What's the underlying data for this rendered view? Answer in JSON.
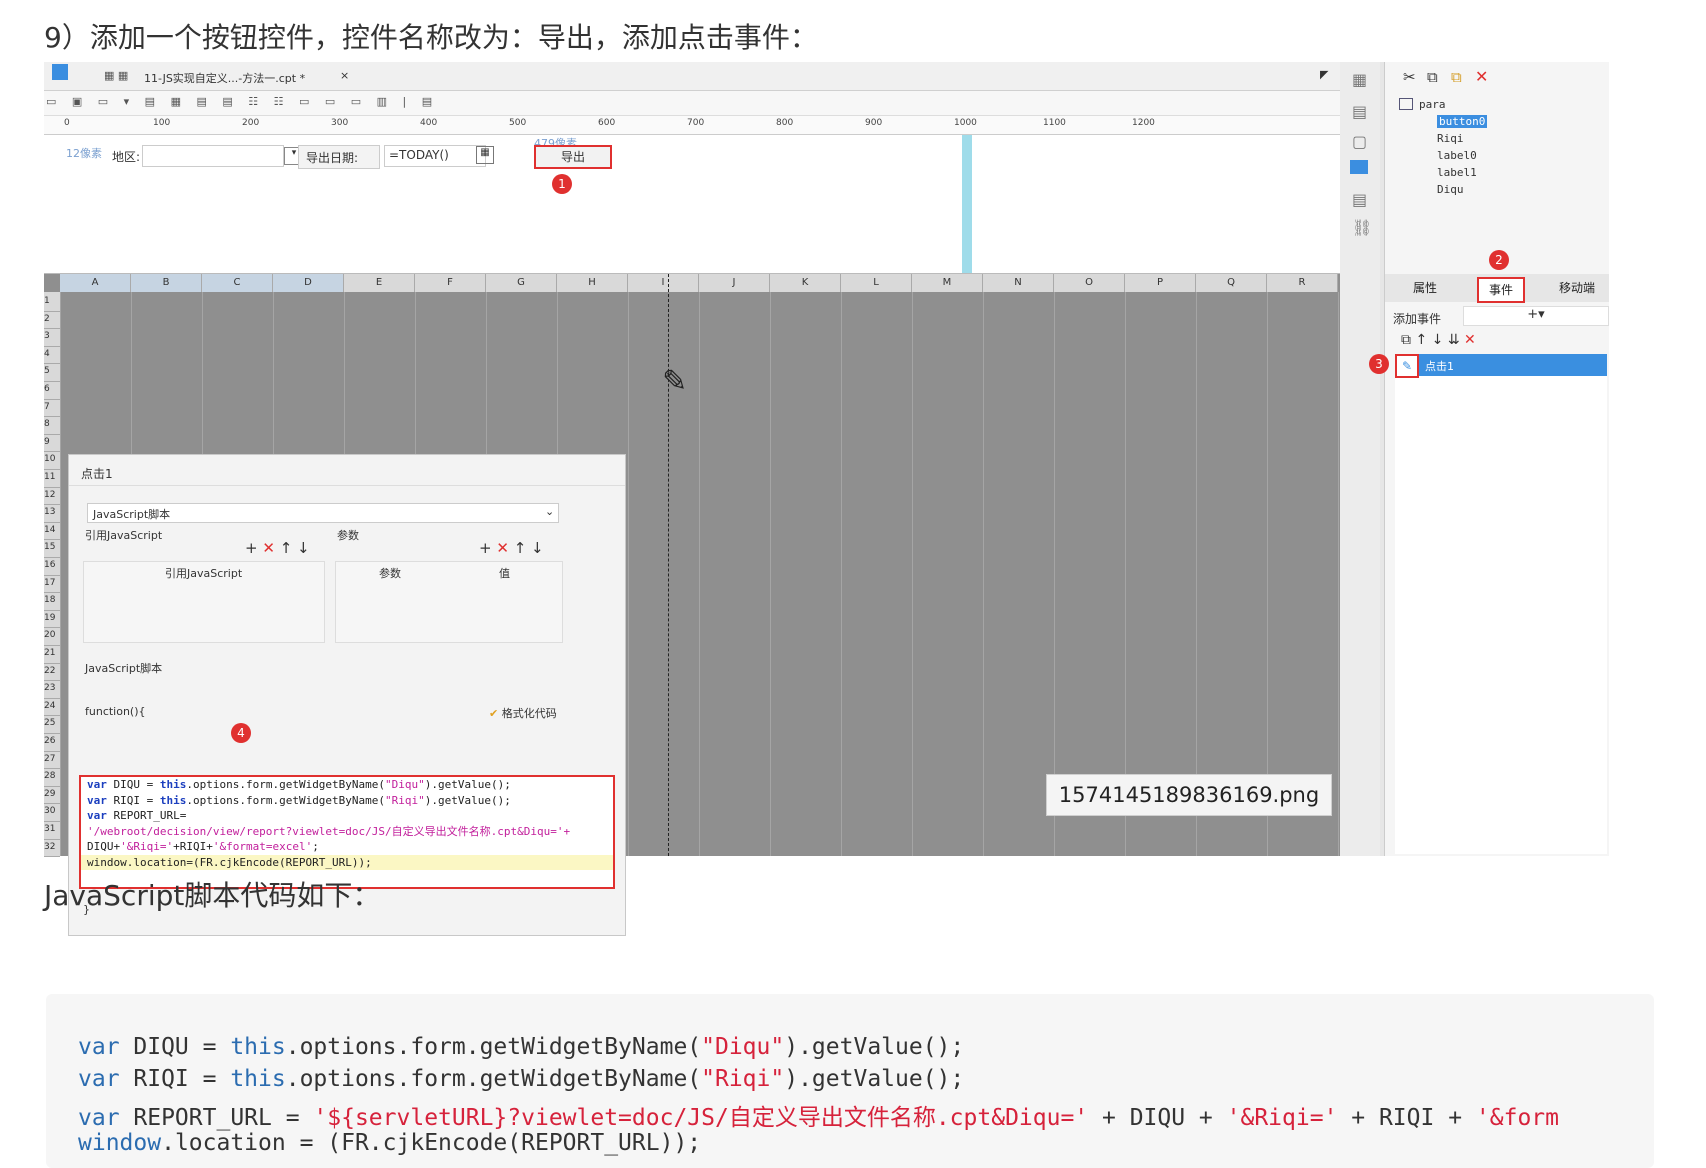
{
  "heading_top": "9）添加一个按钮控件，控件名称改为：导出，添加点击事件：",
  "heading_mid": "JavaScript脚本代码如下：",
  "screenshot": {
    "tab_title": "11-JS实现自定义...-方法一.cpt *",
    "tab_close": "×",
    "ruler_ticks": [
      "0",
      "100",
      "200",
      "300",
      "400",
      "500",
      "600",
      "700",
      "800",
      "900",
      "1000",
      "1100",
      "1200"
    ],
    "param_bar": {
      "px12_label": "12像素",
      "px479_label": "479像素",
      "diqu_label": "地区:",
      "date_label": "导出日期:",
      "date_value": "=TODAY()",
      "export_button": "导出"
    },
    "columns": [
      "A",
      "B",
      "C",
      "D",
      "E",
      "F",
      "G",
      "H",
      "I",
      "J",
      "K",
      "L",
      "M",
      "N",
      "O",
      "P",
      "Q",
      "R"
    ],
    "rows": [
      "1",
      "2",
      "3",
      "4",
      "5",
      "6",
      "7",
      "8",
      "9",
      "10",
      "11",
      "12",
      "13",
      "14",
      "15",
      "16",
      "17",
      "18",
      "19",
      "20",
      "21",
      "22",
      "23",
      "24",
      "25",
      "26",
      "27",
      "28",
      "29",
      "30",
      "31",
      "32"
    ],
    "dialog": {
      "title": "点击1",
      "type_select": "JavaScript脚本",
      "ref_js_label": "引用JavaScript",
      "params_label": "参数",
      "ref_js_col": "引用JavaScript",
      "param_col": "参数",
      "value_col": "值",
      "script_label": "JavaScript脚本",
      "function_open": "function(){",
      "format_code": "格式化代码",
      "function_close": "}",
      "code": [
        "var DIQU = this.options.form.getWidgetByName(\"Diqu\").getValue();",
        "var RIQI = this.options.form.getWidgetByName(\"Riqi\").getValue();",
        "var REPORT_URL=",
        "'/webroot/decision/view/report?viewlet=doc/JS/自定义导出文件名称.cpt&Diqu='+",
        "DIQU+'&Riqi='+RIQI+'&format=excel';",
        "window.location=(FR.cjkEncode(REPORT_URL));"
      ]
    },
    "markers": [
      "1",
      "2",
      "3",
      "4"
    ],
    "tree": {
      "root": "para",
      "items": [
        "button0",
        "Riqi",
        "label0",
        "label1",
        "Diqu"
      ]
    },
    "panel_tabs": [
      "属性",
      "事件",
      "移动端"
    ],
    "add_event_label": "添加事件",
    "add_event_plus": "+▾",
    "event_item": "点击1",
    "tooltip": "1574145189836169.png"
  },
  "code_block": [
    {
      "kw": "var",
      "rest": " DIQU = ",
      "kw2": "this",
      "rest2": ".options.form.getWidgetByName(",
      "str": "\"Diqu\"",
      "tail": ").getValue();"
    },
    {
      "kw": "var",
      "rest": " RIQI = ",
      "kw2": "this",
      "rest2": ".options.form.getWidgetByName(",
      "str": "\"Riqi\"",
      "tail": ").getValue();"
    },
    {
      "kw": "var",
      "rest": " REPORT_URL = ",
      "kw2": "",
      "rest2": "",
      "str": "'${servletURL}?viewlet=doc/JS/自定义导出文件名称.cpt&Diqu='",
      "tail": " + DIQU + ",
      "str2": "'&Riqi='",
      "tail2": " + RIQI + ",
      "str3": "'&form"
    },
    {
      "kw": "window",
      "rest": ".location = (FR.cjkEncode(REPORT_URL));"
    }
  ]
}
